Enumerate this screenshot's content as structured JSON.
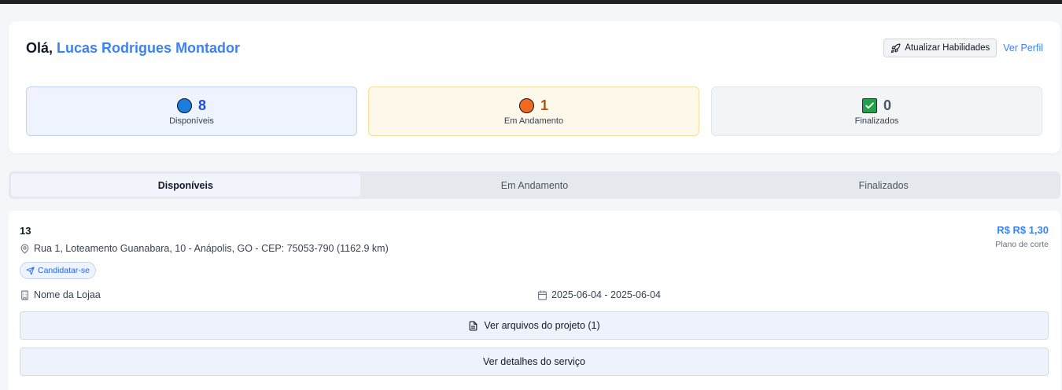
{
  "header": {
    "greeting": "Olá,",
    "user_name": "Lucas Rodrigues Montador",
    "update_skills_label": "Atualizar Habilidades",
    "view_profile_label": "Ver Perfil"
  },
  "stats": [
    {
      "value": "8",
      "label": "Disponíveis",
      "icon": "blue-circle-icon"
    },
    {
      "value": "1",
      "label": "Em Andamento",
      "icon": "orange-circle-icon"
    },
    {
      "value": "0",
      "label": "Finalizados",
      "icon": "check-box-icon"
    }
  ],
  "tabs": [
    {
      "label": "Disponíveis",
      "active": true
    },
    {
      "label": "Em Andamento",
      "active": false
    },
    {
      "label": "Finalizados",
      "active": false
    }
  ],
  "service": {
    "id": "13",
    "address": "Rua 1, Loteamento Guanabara, 10 - Anápolis, GO - CEP: 75053-790 (1162.9 km)",
    "price": "R$ R$ 1,30",
    "price_subtitle": "Plano de corte",
    "apply_label": "Candidatar-se",
    "store": "Nome da Lojaa",
    "dates": "2025-06-04 - 2025-06-04",
    "files_label": "Ver arquivos do projeto (1)",
    "details_label": "Ver detalhes do serviço"
  },
  "colors": {
    "accent": "#3b82f6",
    "available": "#1a7ee0",
    "in_progress": "#f06a1e",
    "done": "#21a24a"
  }
}
